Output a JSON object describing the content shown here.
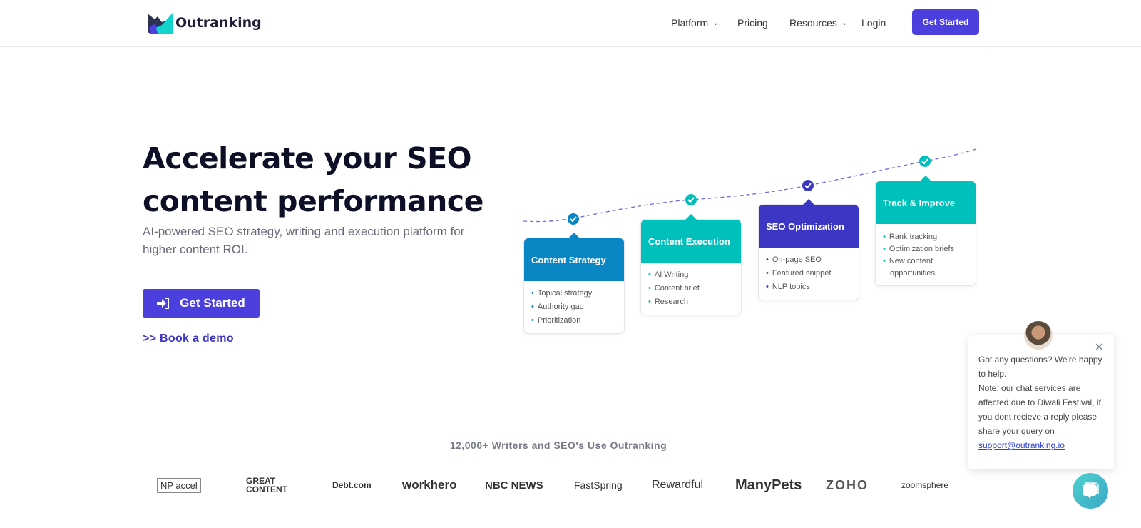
{
  "header": {
    "brand": "Outranking",
    "nav": [
      {
        "label": "Platform",
        "dropdown": true
      },
      {
        "label": "Pricing",
        "dropdown": false
      },
      {
        "label": "Resources",
        "dropdown": true
      },
      {
        "label": "Login",
        "dropdown": false
      }
    ],
    "cta": "Get Started"
  },
  "hero": {
    "title_line1": "Accelerate your SEO",
    "title_line2": "content performance",
    "subtitle": "AI-powered SEO strategy, writing and execution platform for higher content ROI.",
    "cta": "Get Started",
    "demo": ">> Book a demo"
  },
  "steps": [
    {
      "title": "Content Strategy",
      "color": "#0a86c4",
      "items": [
        "Topical strategy",
        "Authority gap",
        "Prioritization"
      ]
    },
    {
      "title": "Content Execution",
      "color": "#00c0bb",
      "items": [
        "AI Writing",
        "Content brief",
        "Research"
      ]
    },
    {
      "title": "SEO Optimization",
      "color": "#3b36c3",
      "items": [
        "On-page SEO",
        "Featured snippet",
        "NLP topics"
      ]
    },
    {
      "title": "Track & Improve",
      "color": "#00c0bb",
      "items": [
        "Rank tracking",
        "Optimization briefs",
        "New content opportunities"
      ]
    }
  ],
  "social_proof": {
    "tagline": "12,000+ Writers and SEO's Use Outranking",
    "logos": [
      "NP accel",
      "GREAT CONTENT",
      "Debt.com",
      "workhero",
      "NBC NEWS",
      "FastSpring",
      "Rewardful",
      "ManyPets",
      "ZOHO",
      "zoomsphere"
    ]
  },
  "chat": {
    "message1": "Got any questions? We're happy to help.",
    "message2": "Note: our chat services are affected due to Diwali Festival, if you dont recieve a reply please share your query on",
    "email": "support@outranking.io"
  }
}
